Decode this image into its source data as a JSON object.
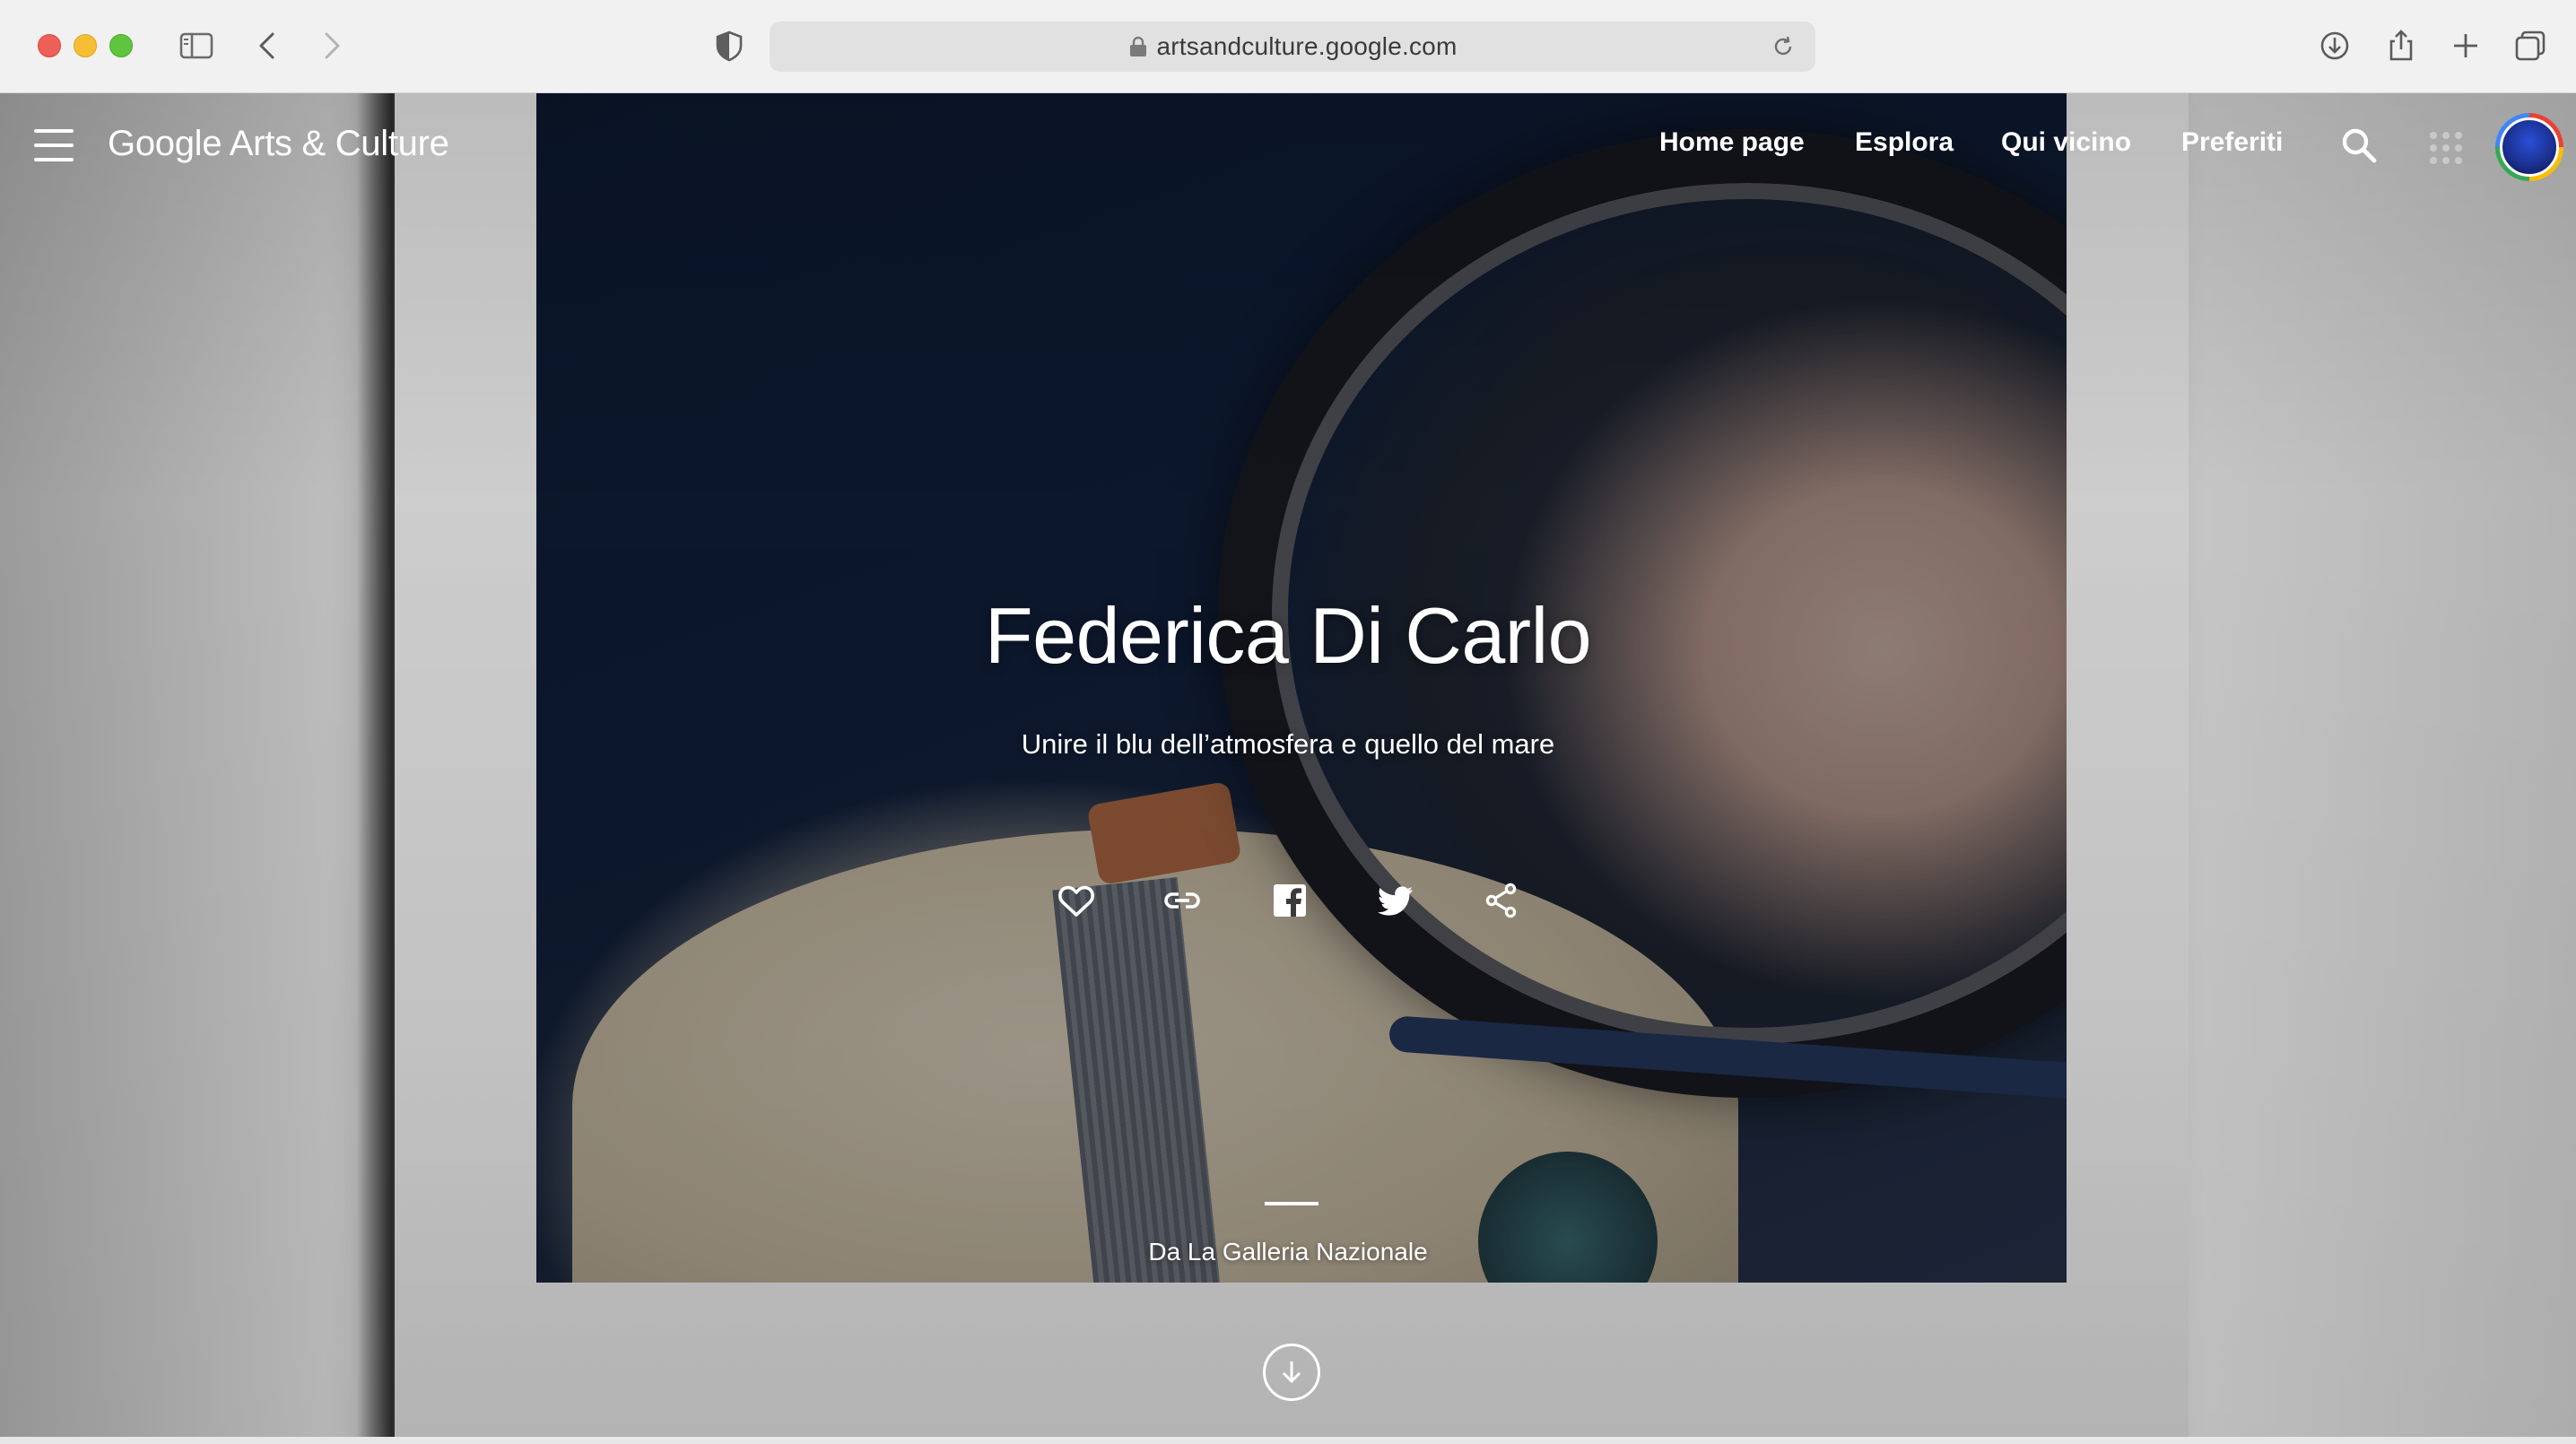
{
  "browser": {
    "url": "artsandculture.google.com"
  },
  "header": {
    "logo": "Google Arts & Culture",
    "nav": [
      {
        "label": "Home page"
      },
      {
        "label": "Esplora"
      },
      {
        "label": "Qui vicino"
      },
      {
        "label": "Preferiti"
      }
    ]
  },
  "hero": {
    "title": "Federica Di Carlo",
    "subtitle": "Unire il blu dell’atmosfera e quello del mare",
    "source": "Da La Galleria Nazionale"
  },
  "actions": {
    "icons": [
      "heart-icon",
      "link-icon",
      "facebook-icon",
      "twitter-icon",
      "share-icon"
    ]
  },
  "colors": {
    "text": "#ffffff",
    "chrome": "#f2f1f2",
    "urlbar": "#e2e1e2"
  }
}
